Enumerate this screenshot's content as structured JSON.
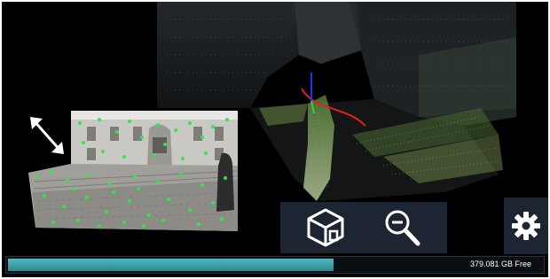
{
  "storage": {
    "free_label": "379.081 GB Free",
    "used_fraction": 0.61,
    "fill_color": "#3aa4aa"
  },
  "toolbar": {
    "view_cube_icon": "view-cube-icon",
    "zoom_out_icon": "zoom-out-icon",
    "settings_icon": "gear-icon"
  },
  "camera_feed": {
    "expand_icon": "expand-arrows-icon",
    "feature_point_color": "#2ee84a"
  },
  "colors": {
    "panel_bg": "#1c2531",
    "icon_color": "#ffffff",
    "trajectory_color": "#e02020",
    "axis_color": "#1a33ff"
  }
}
